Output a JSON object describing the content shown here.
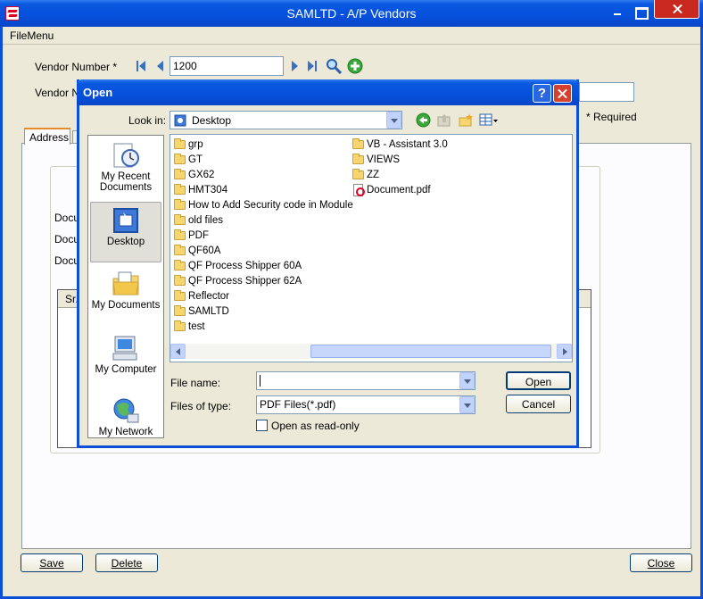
{
  "window": {
    "title": "SAMLTD - A/P Vendors"
  },
  "menu": {
    "file": "FileMenu"
  },
  "form": {
    "vendor_number_label": "Vendor Number *",
    "vendor_number_value": "1200",
    "vendor_name_label": "Vendor N",
    "required_note": "* Required",
    "tab_address": "Address",
    "doc_label_1": "Docu",
    "doc_label_2": "Docu",
    "doc_label_3": "Docu",
    "grid_col_sr": "Sr."
  },
  "buttons": {
    "save": "Save",
    "delete": "Delete",
    "close": "Close"
  },
  "dialog": {
    "title": "Open",
    "help": "?",
    "look_in_label": "Look in:",
    "look_in_value": "Desktop",
    "places": [
      {
        "label": "My Recent Documents",
        "icon": "recent-documents-icon"
      },
      {
        "label": "Desktop",
        "icon": "desktop-icon"
      },
      {
        "label": "My Documents",
        "icon": "my-documents-icon"
      },
      {
        "label": "My Computer",
        "icon": "my-computer-icon"
      },
      {
        "label": "My Network",
        "icon": "my-network-icon"
      }
    ],
    "files_col1": [
      "grp",
      "GT",
      "GX62",
      "HMT304",
      "How to Add Security code in Module",
      "old files",
      "PDF",
      "QF60A",
      "QF Process Shipper 60A",
      "QF Process Shipper 62A",
      "Reflector",
      "SAMLTD",
      "test"
    ],
    "files_col2": [
      "VB - Assistant 3.0",
      "VIEWS",
      "ZZ",
      "Document.pdf"
    ],
    "file_name_label": "File name:",
    "file_name_value": "",
    "file_type_label": "Files of type:",
    "file_type_value": "PDF Files(*.pdf)",
    "read_only_label": "Open as read-only",
    "open_button": "Open",
    "cancel_button": "Cancel"
  }
}
